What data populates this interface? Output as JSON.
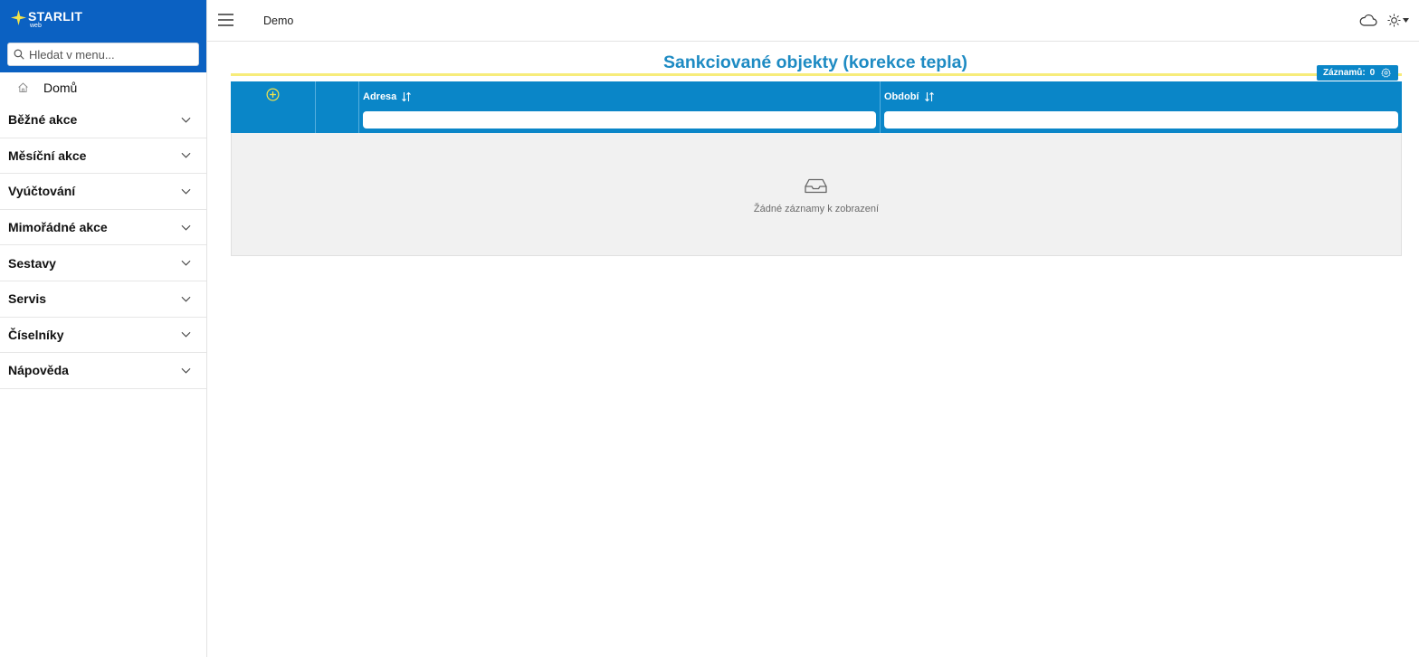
{
  "brand": {
    "name": "STARLIT",
    "sub": "web"
  },
  "sidebar": {
    "search_placeholder": "Hledat v menu...",
    "home_label": "Domů",
    "sections": [
      {
        "label": "Běžné akce"
      },
      {
        "label": "Měsíční akce"
      },
      {
        "label": "Vyúčtování"
      },
      {
        "label": "Mimořádné akce"
      },
      {
        "label": "Sestavy"
      },
      {
        "label": "Servis"
      },
      {
        "label": "Číselníky"
      },
      {
        "label": "Nápověda"
      }
    ]
  },
  "topbar": {
    "breadcrumb": "Demo"
  },
  "main": {
    "title": "Sankciované objekty (korekce tepla)",
    "records_label": "Záznamů:",
    "records_count": "0",
    "columns": [
      {
        "label": "Adresa"
      },
      {
        "label": "Období"
      }
    ],
    "empty_text": "Žádné záznamy k zobrazení"
  },
  "colors": {
    "brand_blue": "#0b61c2",
    "grid_blue": "#0a86c8",
    "title_blue": "#1e8bc3",
    "accent_yellow": "#f7ec7a"
  }
}
